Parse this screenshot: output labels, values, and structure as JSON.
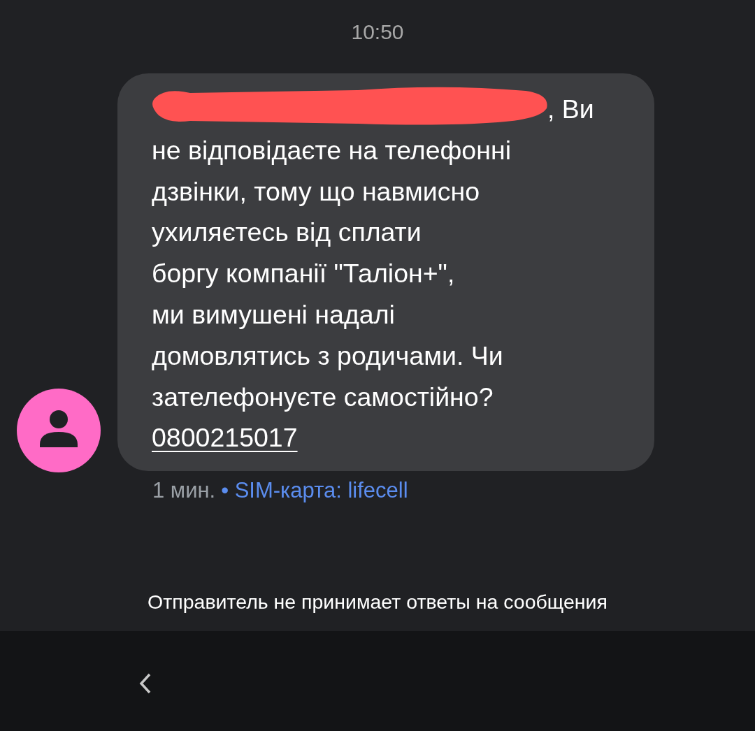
{
  "timestamp": "10:50",
  "message": {
    "redacted": true,
    "lines": [
      ", Ви",
      "не відповідаєте на телефонні",
      "дзвінки, тому що навмисно",
      "ухиляєтесь від сплати",
      "боргу компанії \"Таліон+\",",
      "ми вимушені надалі",
      "домовлятись з родичами. Чи",
      "зателефонуєте самостійно?"
    ],
    "phone": "0800215017"
  },
  "meta": {
    "age": "1 мин.",
    "separator": "•",
    "sim": "SIM-карта: lifecell"
  },
  "notice": "Отправитель не принимает ответы на сообщения"
}
